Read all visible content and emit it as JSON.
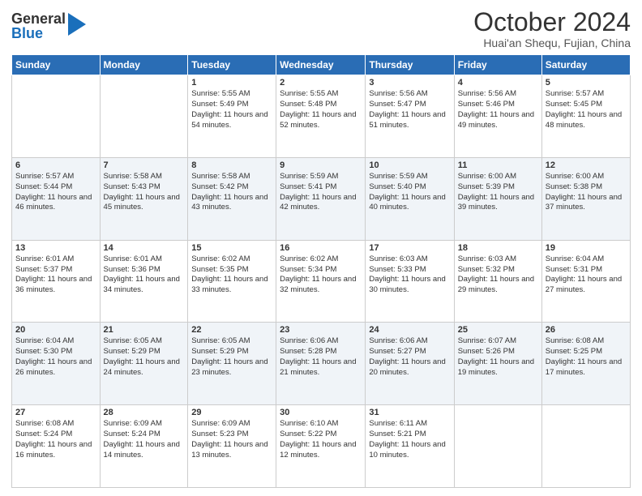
{
  "logo": {
    "text_general": "General",
    "text_blue": "Blue"
  },
  "header": {
    "month": "October 2024",
    "location": "Huai'an Shequ, Fujian, China"
  },
  "days_of_week": [
    "Sunday",
    "Monday",
    "Tuesday",
    "Wednesday",
    "Thursday",
    "Friday",
    "Saturday"
  ],
  "weeks": [
    [
      {
        "day": "",
        "sunrise": "",
        "sunset": "",
        "daylight": ""
      },
      {
        "day": "",
        "sunrise": "",
        "sunset": "",
        "daylight": ""
      },
      {
        "day": "1",
        "sunrise": "Sunrise: 5:55 AM",
        "sunset": "Sunset: 5:49 PM",
        "daylight": "Daylight: 11 hours and 54 minutes."
      },
      {
        "day": "2",
        "sunrise": "Sunrise: 5:55 AM",
        "sunset": "Sunset: 5:48 PM",
        "daylight": "Daylight: 11 hours and 52 minutes."
      },
      {
        "day": "3",
        "sunrise": "Sunrise: 5:56 AM",
        "sunset": "Sunset: 5:47 PM",
        "daylight": "Daylight: 11 hours and 51 minutes."
      },
      {
        "day": "4",
        "sunrise": "Sunrise: 5:56 AM",
        "sunset": "Sunset: 5:46 PM",
        "daylight": "Daylight: 11 hours and 49 minutes."
      },
      {
        "day": "5",
        "sunrise": "Sunrise: 5:57 AM",
        "sunset": "Sunset: 5:45 PM",
        "daylight": "Daylight: 11 hours and 48 minutes."
      }
    ],
    [
      {
        "day": "6",
        "sunrise": "Sunrise: 5:57 AM",
        "sunset": "Sunset: 5:44 PM",
        "daylight": "Daylight: 11 hours and 46 minutes."
      },
      {
        "day": "7",
        "sunrise": "Sunrise: 5:58 AM",
        "sunset": "Sunset: 5:43 PM",
        "daylight": "Daylight: 11 hours and 45 minutes."
      },
      {
        "day": "8",
        "sunrise": "Sunrise: 5:58 AM",
        "sunset": "Sunset: 5:42 PM",
        "daylight": "Daylight: 11 hours and 43 minutes."
      },
      {
        "day": "9",
        "sunrise": "Sunrise: 5:59 AM",
        "sunset": "Sunset: 5:41 PM",
        "daylight": "Daylight: 11 hours and 42 minutes."
      },
      {
        "day": "10",
        "sunrise": "Sunrise: 5:59 AM",
        "sunset": "Sunset: 5:40 PM",
        "daylight": "Daylight: 11 hours and 40 minutes."
      },
      {
        "day": "11",
        "sunrise": "Sunrise: 6:00 AM",
        "sunset": "Sunset: 5:39 PM",
        "daylight": "Daylight: 11 hours and 39 minutes."
      },
      {
        "day": "12",
        "sunrise": "Sunrise: 6:00 AM",
        "sunset": "Sunset: 5:38 PM",
        "daylight": "Daylight: 11 hours and 37 minutes."
      }
    ],
    [
      {
        "day": "13",
        "sunrise": "Sunrise: 6:01 AM",
        "sunset": "Sunset: 5:37 PM",
        "daylight": "Daylight: 11 hours and 36 minutes."
      },
      {
        "day": "14",
        "sunrise": "Sunrise: 6:01 AM",
        "sunset": "Sunset: 5:36 PM",
        "daylight": "Daylight: 11 hours and 34 minutes."
      },
      {
        "day": "15",
        "sunrise": "Sunrise: 6:02 AM",
        "sunset": "Sunset: 5:35 PM",
        "daylight": "Daylight: 11 hours and 33 minutes."
      },
      {
        "day": "16",
        "sunrise": "Sunrise: 6:02 AM",
        "sunset": "Sunset: 5:34 PM",
        "daylight": "Daylight: 11 hours and 32 minutes."
      },
      {
        "day": "17",
        "sunrise": "Sunrise: 6:03 AM",
        "sunset": "Sunset: 5:33 PM",
        "daylight": "Daylight: 11 hours and 30 minutes."
      },
      {
        "day": "18",
        "sunrise": "Sunrise: 6:03 AM",
        "sunset": "Sunset: 5:32 PM",
        "daylight": "Daylight: 11 hours and 29 minutes."
      },
      {
        "day": "19",
        "sunrise": "Sunrise: 6:04 AM",
        "sunset": "Sunset: 5:31 PM",
        "daylight": "Daylight: 11 hours and 27 minutes."
      }
    ],
    [
      {
        "day": "20",
        "sunrise": "Sunrise: 6:04 AM",
        "sunset": "Sunset: 5:30 PM",
        "daylight": "Daylight: 11 hours and 26 minutes."
      },
      {
        "day": "21",
        "sunrise": "Sunrise: 6:05 AM",
        "sunset": "Sunset: 5:29 PM",
        "daylight": "Daylight: 11 hours and 24 minutes."
      },
      {
        "day": "22",
        "sunrise": "Sunrise: 6:05 AM",
        "sunset": "Sunset: 5:29 PM",
        "daylight": "Daylight: 11 hours and 23 minutes."
      },
      {
        "day": "23",
        "sunrise": "Sunrise: 6:06 AM",
        "sunset": "Sunset: 5:28 PM",
        "daylight": "Daylight: 11 hours and 21 minutes."
      },
      {
        "day": "24",
        "sunrise": "Sunrise: 6:06 AM",
        "sunset": "Sunset: 5:27 PM",
        "daylight": "Daylight: 11 hours and 20 minutes."
      },
      {
        "day": "25",
        "sunrise": "Sunrise: 6:07 AM",
        "sunset": "Sunset: 5:26 PM",
        "daylight": "Daylight: 11 hours and 19 minutes."
      },
      {
        "day": "26",
        "sunrise": "Sunrise: 6:08 AM",
        "sunset": "Sunset: 5:25 PM",
        "daylight": "Daylight: 11 hours and 17 minutes."
      }
    ],
    [
      {
        "day": "27",
        "sunrise": "Sunrise: 6:08 AM",
        "sunset": "Sunset: 5:24 PM",
        "daylight": "Daylight: 11 hours and 16 minutes."
      },
      {
        "day": "28",
        "sunrise": "Sunrise: 6:09 AM",
        "sunset": "Sunset: 5:24 PM",
        "daylight": "Daylight: 11 hours and 14 minutes."
      },
      {
        "day": "29",
        "sunrise": "Sunrise: 6:09 AM",
        "sunset": "Sunset: 5:23 PM",
        "daylight": "Daylight: 11 hours and 13 minutes."
      },
      {
        "day": "30",
        "sunrise": "Sunrise: 6:10 AM",
        "sunset": "Sunset: 5:22 PM",
        "daylight": "Daylight: 11 hours and 12 minutes."
      },
      {
        "day": "31",
        "sunrise": "Sunrise: 6:11 AM",
        "sunset": "Sunset: 5:21 PM",
        "daylight": "Daylight: 11 hours and 10 minutes."
      },
      {
        "day": "",
        "sunrise": "",
        "sunset": "",
        "daylight": ""
      },
      {
        "day": "",
        "sunrise": "",
        "sunset": "",
        "daylight": ""
      }
    ]
  ]
}
